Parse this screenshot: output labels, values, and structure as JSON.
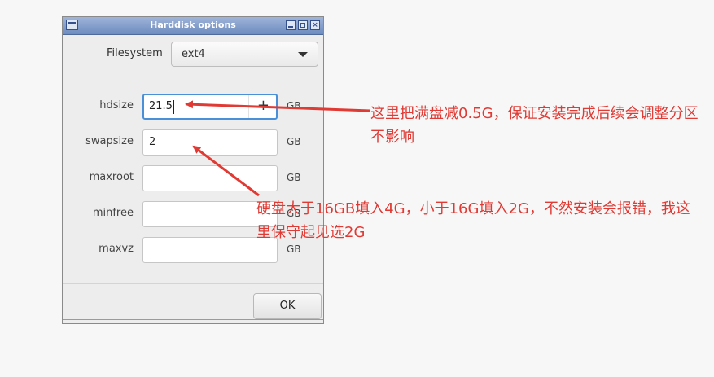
{
  "dialog": {
    "title": "Harddisk options",
    "filesystem": {
      "label": "Filesystem",
      "value": "ext4"
    },
    "fields": [
      {
        "label": "hdsize",
        "value": "21.5",
        "unit": "GB"
      },
      {
        "label": "swapsize",
        "value": "2",
        "unit": "GB"
      },
      {
        "label": "maxroot",
        "value": "",
        "unit": "GB"
      },
      {
        "label": "minfree",
        "value": "",
        "unit": "GB"
      },
      {
        "label": "maxvz",
        "value": "",
        "unit": "GB"
      }
    ],
    "ok_label": "OK",
    "spin_plus": "+"
  },
  "annotations": {
    "note1": "这里把满盘减0.5G，保证安装完成后续会调整分区不影响",
    "note2": "硬盘大于16GB填入4G，小于16G填入2G，不然安装会报错，我这里保守起见选2G",
    "color": "#e03a34"
  },
  "icons": [
    "window-menu-icon",
    "minimize-icon",
    "maximize-icon",
    "close-icon",
    "dropdown-caret-icon"
  ]
}
